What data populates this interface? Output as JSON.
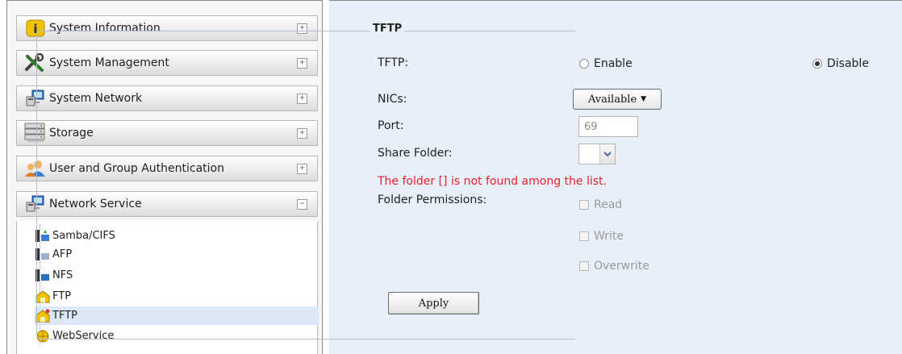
{
  "sidebar": {
    "sections": [
      {
        "label": "System Information",
        "icon": "info-icon",
        "toggle": "+"
      },
      {
        "label": "System Management",
        "icon": "tools-icon",
        "toggle": "+"
      },
      {
        "label": "System Network",
        "icon": "network-icon",
        "toggle": "+"
      },
      {
        "label": "Storage",
        "icon": "storage-icon",
        "toggle": "+"
      },
      {
        "label": "User and Group Authentication",
        "icon": "users-icon",
        "toggle": "+"
      },
      {
        "label": "Network Service",
        "icon": "network-icon",
        "toggle": "−"
      }
    ],
    "tree": [
      {
        "label": "Samba/CIFS",
        "icon": "samba-icon"
      },
      {
        "label": "AFP",
        "icon": "afp-icon"
      },
      {
        "label": "NFS",
        "icon": "nfs-icon"
      },
      {
        "label": "FTP",
        "icon": "ftp-icon"
      },
      {
        "label": "TFTP",
        "icon": "tftp-icon",
        "selected": true
      },
      {
        "label": "WebService",
        "icon": "webservice-icon"
      }
    ]
  },
  "form": {
    "legend": "TFTP",
    "tftp_label": "TFTP:",
    "enable_label": "Enable",
    "disable_label": "Disable",
    "tftp_value": "Disable",
    "nics_label": "NICs:",
    "nics_value": "Available",
    "port_label": "Port:",
    "port_value": "69",
    "share_label": "Share Folder:",
    "error_message": "The folder [] is not found among the list.",
    "perm_label": "Folder Permissions:",
    "perm_read": "Read",
    "perm_write": "Write",
    "perm_overwrite": "Overwrite",
    "apply_label": "Apply"
  },
  "colors": {
    "error": "#e8202a",
    "selected_bg": "#dce8f7",
    "panel_bg": "#e8eff8"
  }
}
